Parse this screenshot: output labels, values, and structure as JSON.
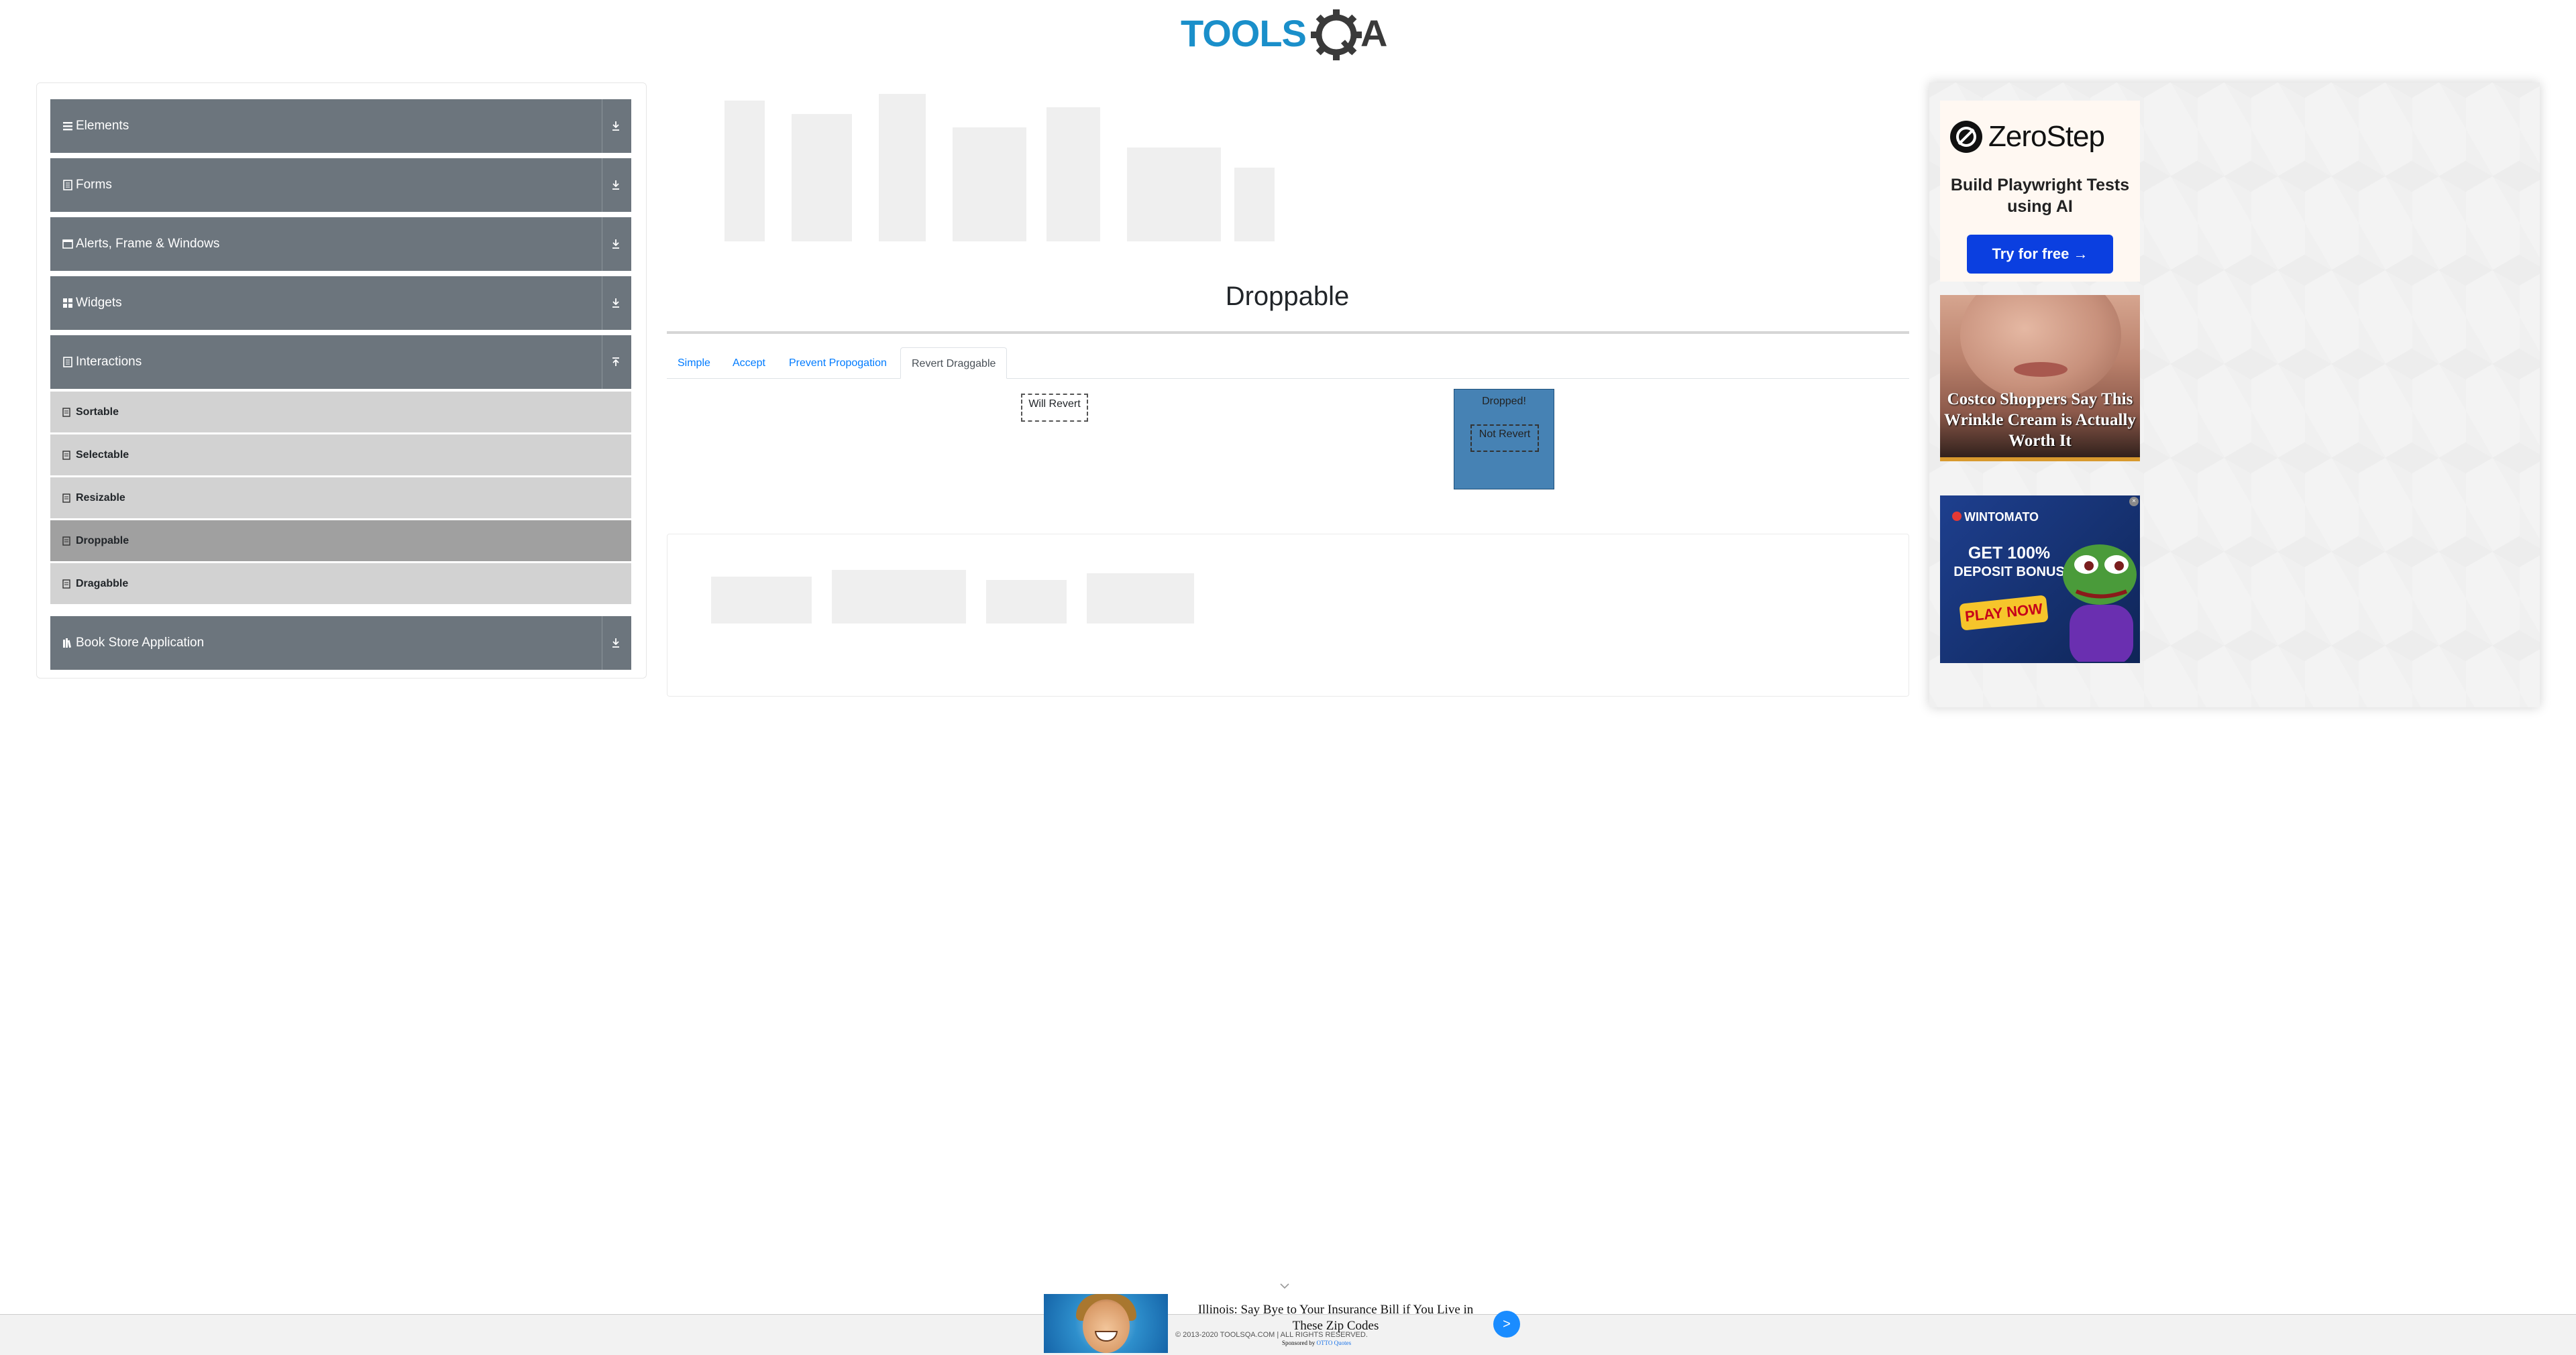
{
  "logo": {
    "text_left": "TOOLS",
    "text_right": "A",
    "brand_blue": "#1a8fca",
    "brand_dark": "#3a3a3a"
  },
  "sidebar": {
    "groups": [
      {
        "label": "Elements",
        "icon": "list-icon",
        "state": "collapsed"
      },
      {
        "label": "Forms",
        "icon": "document-icon",
        "state": "collapsed"
      },
      {
        "label": "Alerts, Frame & Windows",
        "icon": "window-icon",
        "state": "collapsed"
      },
      {
        "label": "Widgets",
        "icon": "grid-icon",
        "state": "collapsed"
      },
      {
        "label": "Interactions",
        "icon": "document-icon",
        "state": "expanded"
      },
      {
        "label": "Book Store Application",
        "icon": "books-icon",
        "state": "collapsed"
      }
    ],
    "interaction_items": [
      {
        "label": "Sortable",
        "active": false
      },
      {
        "label": "Selectable",
        "active": false
      },
      {
        "label": "Resizable",
        "active": false
      },
      {
        "label": "Droppable",
        "active": true
      },
      {
        "label": "Dragabble",
        "active": false
      }
    ],
    "header_color": "#6c757d",
    "item_color": "#d2d2d2",
    "active_item_color": "#a0a0a0"
  },
  "main": {
    "title": "Droppable",
    "tabs": [
      {
        "label": "Simple",
        "active": false
      },
      {
        "label": "Accept",
        "active": false
      },
      {
        "label": "Prevent Propogation",
        "active": false
      },
      {
        "label": "Revert Draggable",
        "active": true
      }
    ],
    "drag_box_label": "Will Revert",
    "drop_box_label": "Dropped!",
    "inner_drag_label": "Not Revert",
    "drop_color": "#4682b4"
  },
  "ads": {
    "zerostep": {
      "brand": "ZeroStep",
      "copy": "Build Playwright Tests using AI",
      "button": "Try for free →"
    },
    "wrinkle": {
      "caption": "Costco Shoppers Say This Wrinkle Cream is Actually Worth It"
    },
    "casino": {
      "brand": "WINTOMATO",
      "headline_big": "GET 100%",
      "headline_small": "DEPOSIT BONUS",
      "button": "PLAY NOW"
    },
    "bottom": {
      "headline": "Illinois: Say Bye to Your Insurance Bill if You Live in These Zip Codes",
      "sponsor_prefix": "Sponsored by",
      "sponsor_brand": "OTTO Quotes",
      "go_glyph": ">"
    }
  },
  "footer": {
    "copyright": "© 2013-2020 TOOLSQA.COM | ALL RIGHTS RESERVED."
  }
}
